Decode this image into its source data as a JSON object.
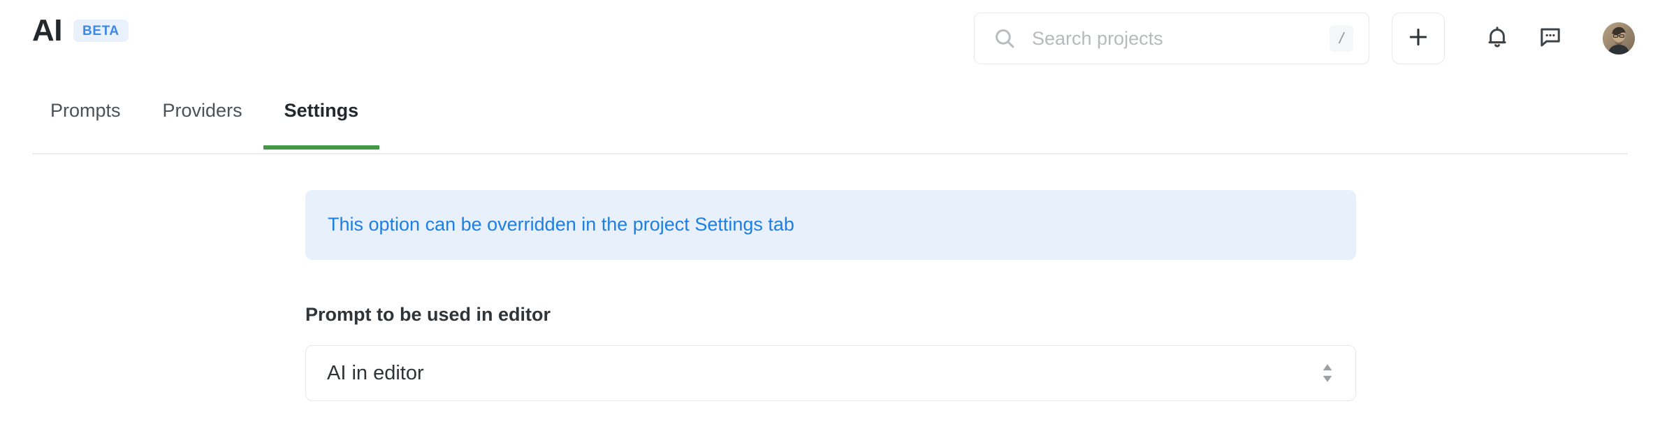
{
  "header": {
    "brand_title": "AI",
    "beta_label": "BETA",
    "search": {
      "placeholder": "Search projects",
      "value": "",
      "icon": "search-icon",
      "shortcut_key": "/"
    },
    "actions": [
      {
        "name": "add-button",
        "icon": "plus-icon",
        "label": "+"
      },
      {
        "name": "notifications-button",
        "icon": "bell-icon"
      },
      {
        "name": "messages-button",
        "icon": "chat-bubble-dots-icon"
      },
      {
        "name": "user-avatar",
        "icon": "avatar-image"
      }
    ]
  },
  "tabs": [
    {
      "label": "Prompts",
      "active": false
    },
    {
      "label": "Providers",
      "active": false
    },
    {
      "label": "Settings",
      "active": true
    }
  ],
  "main": {
    "info_banner": {
      "text": "This option can be overridden in the project Settings tab"
    },
    "prompt_field": {
      "label": "Prompt to be used in editor",
      "selected_value": "AI in editor",
      "options": [
        "AI in editor"
      ]
    }
  },
  "colors": {
    "accent_green": "#429846",
    "link_blue": "#1f7fe0",
    "banner_bg": "#e7f0fb",
    "badge_bg": "#e9f1fd",
    "badge_text": "#3c88e5",
    "text_primary": "#23282d",
    "text_secondary": "#4b5257",
    "border": "#e6e8ea"
  }
}
